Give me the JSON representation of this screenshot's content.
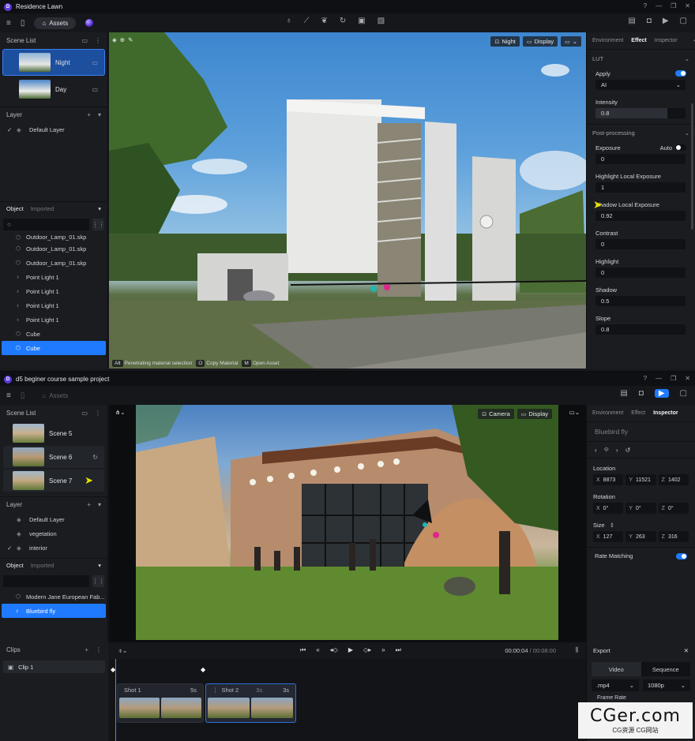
{
  "win1": {
    "title": "Residence Lawn",
    "assets_label": "Assets",
    "scene_list_label": "Scene List",
    "scenes": [
      {
        "name": "Night"
      },
      {
        "name": "Day"
      }
    ],
    "layer_label": "Layer",
    "layers": [
      {
        "name": "Default Layer"
      }
    ],
    "object_tab": "Object",
    "imported_tab": "Imported",
    "objects": [
      {
        "name": "Outdoor_Lamp_01.skp"
      },
      {
        "name": "Outdoor_Lamp_01.skp"
      },
      {
        "name": "Outdoor_Lamp_01.skp"
      },
      {
        "name": "Point Light 1"
      },
      {
        "name": "Point Light 1"
      },
      {
        "name": "Point Light 1"
      },
      {
        "name": "Point Light 1"
      },
      {
        "name": "Cube"
      },
      {
        "name": "Cube"
      }
    ],
    "viewport": {
      "scene_btn": "Night",
      "display_btn": "Display"
    },
    "hints": [
      {
        "key": "Alt",
        "label": "Penetrating material selection"
      },
      {
        "key": "O",
        "label": "Copy Material"
      },
      {
        "key": "M",
        "label": "Open Asset"
      }
    ],
    "tabs": {
      "environment": "Environment",
      "effect": "Effect",
      "inspector": "Inspector"
    },
    "lut": {
      "section": "LUT",
      "apply_label": "Apply",
      "preset": "AI",
      "intensity_label": "Intensity",
      "intensity": "0.8",
      "intensity_fraction": 0.8
    },
    "post": {
      "section": "Post-processing",
      "exposure_label": "Exposure",
      "auto_label": "Auto",
      "exposure": "0",
      "highlight_local_label": "Highlight Local Exposure",
      "highlight_local": "1",
      "shadow_local_label": "Shadow Local Exposure",
      "shadow_local": "0.92",
      "contrast_label": "Contrast",
      "contrast": "0",
      "highlight_label": "Highlight",
      "highlight": "0",
      "shadow_label": "Shadow",
      "shadow": "0.5",
      "slope_label": "Slope",
      "slope": "0.8"
    }
  },
  "win2": {
    "title": "d5 beginer course sample project",
    "assets_label": "Assets",
    "scene_list_label": "Scene List",
    "scenes": [
      {
        "name": "Scene 5"
      },
      {
        "name": "Scene 6"
      },
      {
        "name": "Scene 7"
      }
    ],
    "layer_label": "Layer",
    "layers": [
      {
        "name": "Default Layer"
      },
      {
        "name": "vegetation"
      },
      {
        "name": "interior"
      }
    ],
    "object_tab": "Object",
    "imported_tab": "Imported",
    "objects": [
      {
        "name": "Modern Jane European Fab..."
      },
      {
        "name": "Bluebird fly"
      }
    ],
    "viewport": {
      "camera_btn": "Camera",
      "display_btn": "Display"
    },
    "tabs": {
      "environment": "Environment",
      "effect": "Effect",
      "inspector": "Inspector"
    },
    "inspector": {
      "object_name": "Bluebird fly",
      "location_label": "Location",
      "location": {
        "x": "8873",
        "y": "11521",
        "z": "1402"
      },
      "rotation_label": "Rotation",
      "rotation": {
        "x": "0°",
        "y": "0°",
        "z": "0°"
      },
      "size_label": "Size",
      "size": {
        "x": "127",
        "y": "263",
        "z": "316"
      },
      "rate_label": "Rate Matching"
    },
    "clips_label": "Clips",
    "clips": [
      {
        "name": "Clip 1"
      }
    ],
    "timeline": {
      "current": "00:00:04",
      "total": "/ 00:08:00"
    },
    "shots": [
      {
        "name": "Shot 1",
        "duration": "5s"
      },
      {
        "name": "Shot 2",
        "duration": "3s",
        "duration2": "3s"
      }
    ],
    "export": {
      "title": "Export",
      "tab_video": "Video",
      "tab_sequence": "Sequence",
      "format": ".mp4",
      "resolution": "1080p",
      "frame_rate_label": "Frame Rate"
    }
  },
  "watermark": {
    "main": "CGer.com",
    "sub": "CG资源 CG网站"
  },
  "colors": {
    "accent": "#1f7aff",
    "panel": "#1a1c20",
    "titlebar": "#0f1013"
  }
}
